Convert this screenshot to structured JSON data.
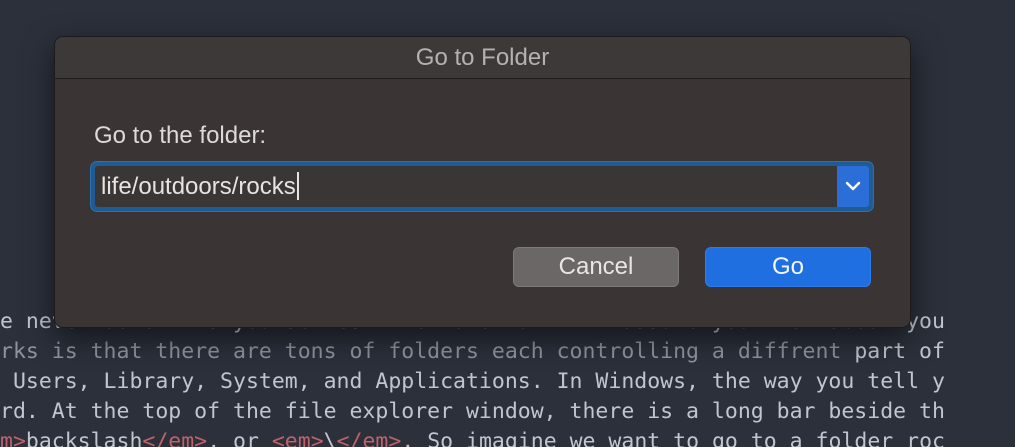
{
  "dialog": {
    "title": "Go to Folder",
    "prompt": "Go to the folder:",
    "path_value": "life/outdoors/rocks",
    "cancel_label": "Cancel",
    "go_label": "Go",
    "dropdown_icon": "chevron-down-icon"
  },
  "background_text": {
    "line1": "e never done this yourselves. The tutorial will assume you know about you",
    "line2_a": "rks is that there are tons of folders each controlling a diffrent",
    "line2_b": " part of",
    "line3": " Users, Library, System, and Applications. In Windows, the way you tell y",
    "line4": "rd. At the top of the file explorer window, there is a long bar beside th",
    "line5_a": "m>",
    "line5_b": "backslash",
    "line5_c": "</em>",
    "line5_d": ", or ",
    "line5_e": "<em>",
    "line5_f": "\\",
    "line5_g": "</em>",
    "line5_h": ". So imagine we want to go to a folder roc"
  },
  "colors": {
    "accent": "#1f6fe0",
    "background": "#2b303b",
    "dialog": "#3a3534"
  }
}
